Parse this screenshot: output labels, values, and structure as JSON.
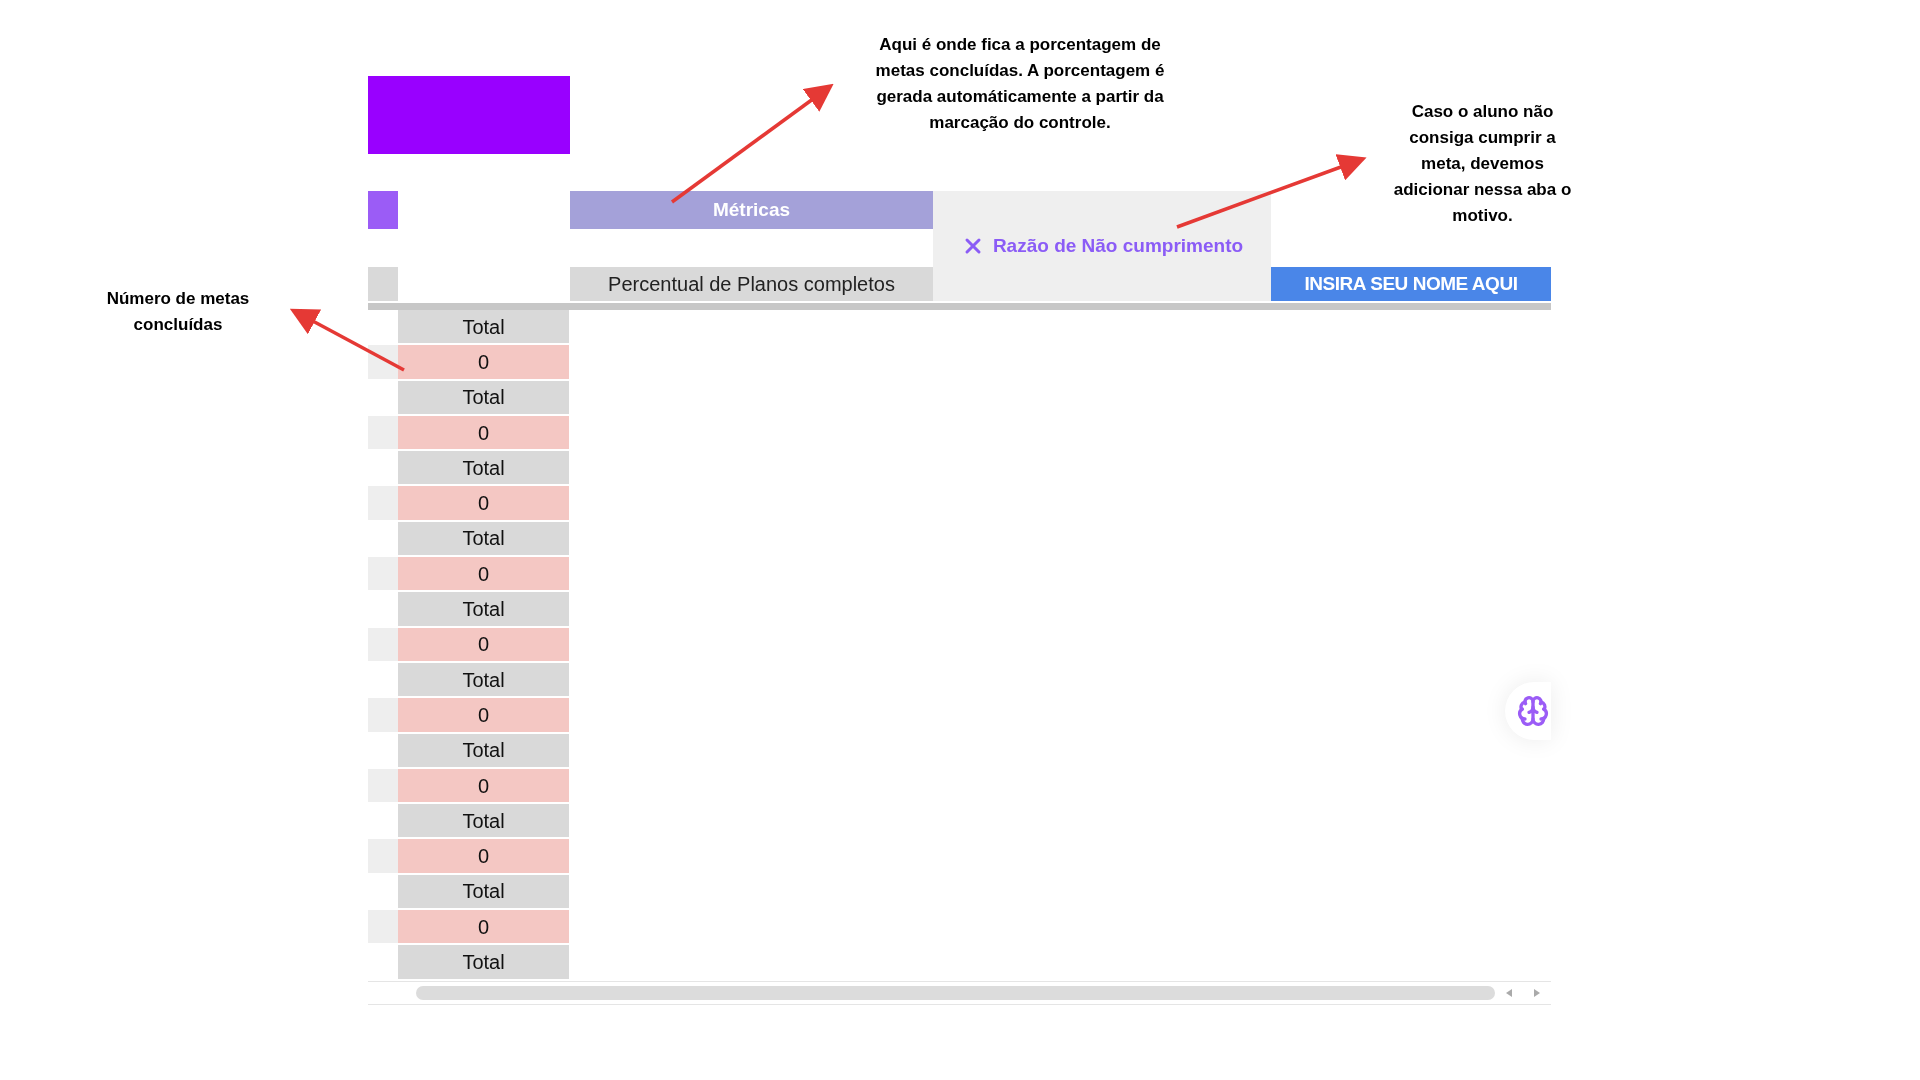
{
  "annotations": [
    {
      "kind": "top",
      "text": "Aqui é onde fica a porcentagem de metas concluídas. A porcentagem é gerada automáticamente a partir da marcação do controle."
    },
    {
      "kind": "right",
      "text": "Caso o aluno não consiga cumprir a meta, devemos adicionar nessa aba o motivo."
    },
    {
      "kind": "left",
      "text": "Número de metas concluídas"
    }
  ],
  "sheet": {
    "header": "Métricas",
    "reason_tab": "Razão de Não cumprimento",
    "column_header": "Percentual de Planos completos",
    "name_button": "INSIRA SEU NOME AQUI",
    "rows": [
      {
        "kind": "label",
        "text": "Total"
      },
      {
        "kind": "value",
        "text": "0"
      },
      {
        "kind": "label",
        "text": "Total"
      },
      {
        "kind": "value",
        "text": "0"
      },
      {
        "kind": "label",
        "text": "Total"
      },
      {
        "kind": "value",
        "text": "0"
      },
      {
        "kind": "label",
        "text": "Total"
      },
      {
        "kind": "value",
        "text": "0"
      },
      {
        "kind": "label",
        "text": "Total"
      },
      {
        "kind": "value",
        "text": "0"
      },
      {
        "kind": "label",
        "text": "Total"
      },
      {
        "kind": "value",
        "text": "0"
      },
      {
        "kind": "label",
        "text": "Total"
      },
      {
        "kind": "value",
        "text": "0"
      },
      {
        "kind": "label",
        "text": "Total"
      },
      {
        "kind": "value",
        "text": "0"
      },
      {
        "kind": "label",
        "text": "Total"
      },
      {
        "kind": "value",
        "text": "0"
      },
      {
        "kind": "label",
        "text": "Total"
      }
    ]
  }
}
